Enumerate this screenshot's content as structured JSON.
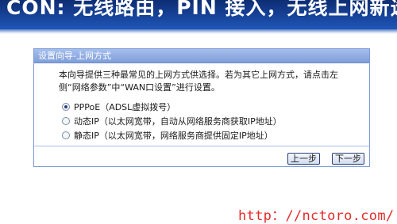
{
  "banner": {
    "text": "CON: 无线路由，PIN 接入，无线上网新选择"
  },
  "wizard": {
    "title": "设置向导-上网方式",
    "description": "本向导提供三种最常见的上网方式供选择。若为其它上网方式，请点击左侧“网络参数”中“WAN口设置”进行设置。",
    "options": [
      {
        "label": "PPPoE（ADSL虚拟拨号）",
        "checked": true
      },
      {
        "label": "动态IP（以太网宽带，自动从网络服务商获取IP地址）",
        "checked": false
      },
      {
        "label": "静态IP（以太网宽带，网络服务商提供固定IP地址）",
        "checked": false
      }
    ],
    "prev_label": "上一步",
    "next_label": "下一步"
  },
  "watermark": "http：//nctoro.com/",
  "colors": {
    "banner": "#17439a",
    "panel_header": "#8fabe0",
    "panel_border": "#7d9bd6",
    "watermark": "#e32a2a"
  }
}
